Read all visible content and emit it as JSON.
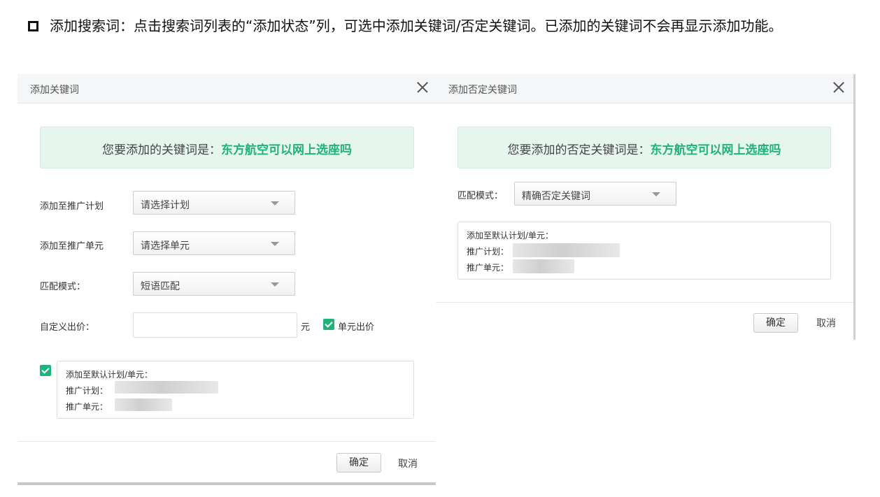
{
  "note": {
    "text": "添加搜索词：点击搜索词列表的“添加状态”列，可选中添加关键词/否定关键词。已添加的关键词不会再显示添加功能。"
  },
  "dialog_keyword": {
    "title": "添加关键词",
    "banner_prefix": "您要添加的关键词是：",
    "banner_keyword": "东方航空可以网上选座吗",
    "plan_label": "添加至推广计划",
    "plan_value": "请选择计划",
    "unit_label": "添加至推广单元",
    "unit_value": "请选择单元",
    "match_label": "匹配模式：",
    "match_value": "短语匹配",
    "bid_label": "自定义出价：",
    "bid_value": "",
    "bid_unit": "元",
    "unit_bid_label": "单元出价",
    "default_title": "添加至默认计划/单元：",
    "default_plan_label": "推广计划：",
    "default_unit_label": "推广单元：",
    "ok_label": "确定",
    "cancel_label": "取消"
  },
  "dialog_negative": {
    "title": "添加否定关键词",
    "banner_prefix": "您要添加的否定关键词是：",
    "banner_keyword": "东方航空可以网上选座吗",
    "match_label": "匹配模式：",
    "match_value": "精确否定关键词",
    "default_title": "添加至默认计划/单元：",
    "default_plan_label": "推广计划：",
    "default_unit_label": "推广单元：",
    "ok_label": "确定",
    "cancel_label": "取消"
  },
  "colors": {
    "accent_green": "#21b27a",
    "banner_bg": "#e6f6ef"
  }
}
